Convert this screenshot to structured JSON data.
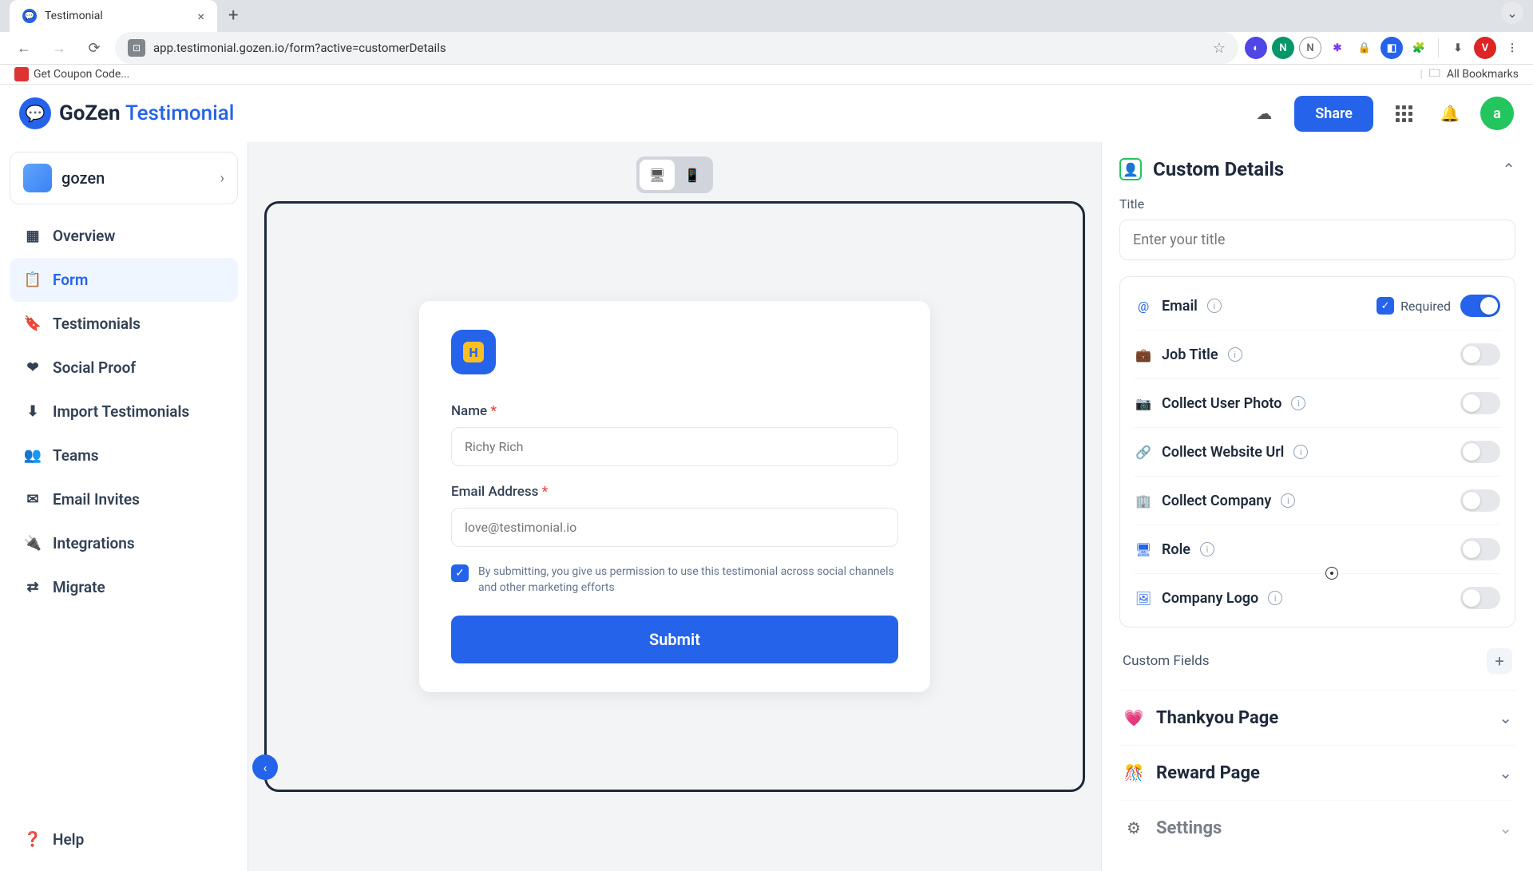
{
  "browser": {
    "tab_title": "Testimonial",
    "url": "app.testimonial.gozen.io/form?active=customerDetails",
    "bookmark": "Get Coupon Code...",
    "all_bookmarks": "All Bookmarks"
  },
  "header": {
    "logo_main": "GoZen",
    "logo_sub": "Testimonial",
    "share": "Share",
    "avatar": "a"
  },
  "sidebar": {
    "workspace": "gozen",
    "items": [
      {
        "icon": "grid",
        "label": "Overview"
      },
      {
        "icon": "form",
        "label": "Form"
      },
      {
        "icon": "bookmark",
        "label": "Testimonials"
      },
      {
        "icon": "heart",
        "label": "Social Proof"
      },
      {
        "icon": "download",
        "label": "Import Testimonials"
      },
      {
        "icon": "users",
        "label": "Teams"
      },
      {
        "icon": "mail",
        "label": "Email Invites"
      },
      {
        "icon": "plug",
        "label": "Integrations"
      },
      {
        "icon": "migrate",
        "label": "Migrate"
      }
    ],
    "help": "Help"
  },
  "form_preview": {
    "logo_letter": "H",
    "name_label": "Name",
    "name_placeholder": "Richy Rich",
    "email_label": "Email Address",
    "email_placeholder": "love@testimonial.io",
    "consent": "By submitting, you give us permission to use this testimonial across social channels and other marketing efforts",
    "submit": "Submit"
  },
  "panel": {
    "title": "Custom Details",
    "title_field_label": "Title",
    "title_placeholder": "Enter your title",
    "required_label": "Required",
    "options": [
      {
        "id": "email",
        "label": "Email",
        "icon": "@",
        "required": true,
        "enabled": true
      },
      {
        "id": "job_title",
        "label": "Job Title",
        "icon": "briefcase",
        "enabled": false
      },
      {
        "id": "user_photo",
        "label": "Collect User Photo",
        "icon": "camera",
        "enabled": false
      },
      {
        "id": "website",
        "label": "Collect Website Url",
        "icon": "link",
        "enabled": false
      },
      {
        "id": "company",
        "label": "Collect Company",
        "icon": "building",
        "enabled": false
      },
      {
        "id": "role",
        "label": "Role",
        "icon": "monitor",
        "enabled": false
      },
      {
        "id": "logo",
        "label": "Company Logo",
        "icon": "image",
        "enabled": false
      }
    ],
    "custom_fields": "Custom Fields",
    "sections": [
      {
        "icon": "💗",
        "label": "Thankyou Page"
      },
      {
        "icon": "🎊",
        "label": "Reward Page"
      },
      {
        "icon": "⚙",
        "label": "Settings"
      }
    ]
  }
}
